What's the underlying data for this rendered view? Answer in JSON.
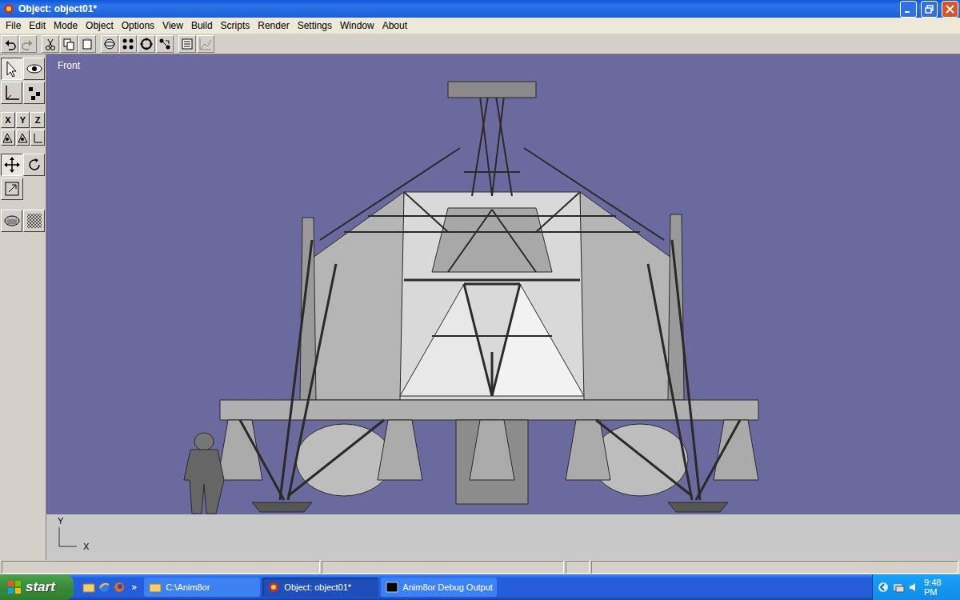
{
  "window": {
    "title": "Object: object01*"
  },
  "menu": [
    "File",
    "Edit",
    "Mode",
    "Object",
    "Options",
    "View",
    "Build",
    "Scripts",
    "Render",
    "Settings",
    "Window",
    "About"
  ],
  "toolbox": {
    "tools": [
      {
        "selected": true
      },
      {
        "selected": false
      },
      {
        "selected": false
      },
      {
        "selected": false
      }
    ],
    "axis_buttons": [
      {
        "label": "X",
        "selected": false
      },
      {
        "label": "Y",
        "selected": false
      },
      {
        "label": "Z",
        "selected": false
      }
    ],
    "transform_tools": [
      {
        "selected": true
      },
      {
        "selected": false
      },
      {
        "selected": false
      }
    ]
  },
  "viewport": {
    "label": "Front",
    "axis": {
      "y": "Y",
      "x": "X"
    }
  },
  "taskbar": {
    "start": "start",
    "more": "»",
    "tasks": [
      {
        "label": "C:\\Anim8or",
        "selected": false
      },
      {
        "label": "Object: object01*",
        "selected": true
      },
      {
        "label": "Anim8or Debug Output",
        "selected": false
      }
    ],
    "clock": "9:48 PM"
  }
}
